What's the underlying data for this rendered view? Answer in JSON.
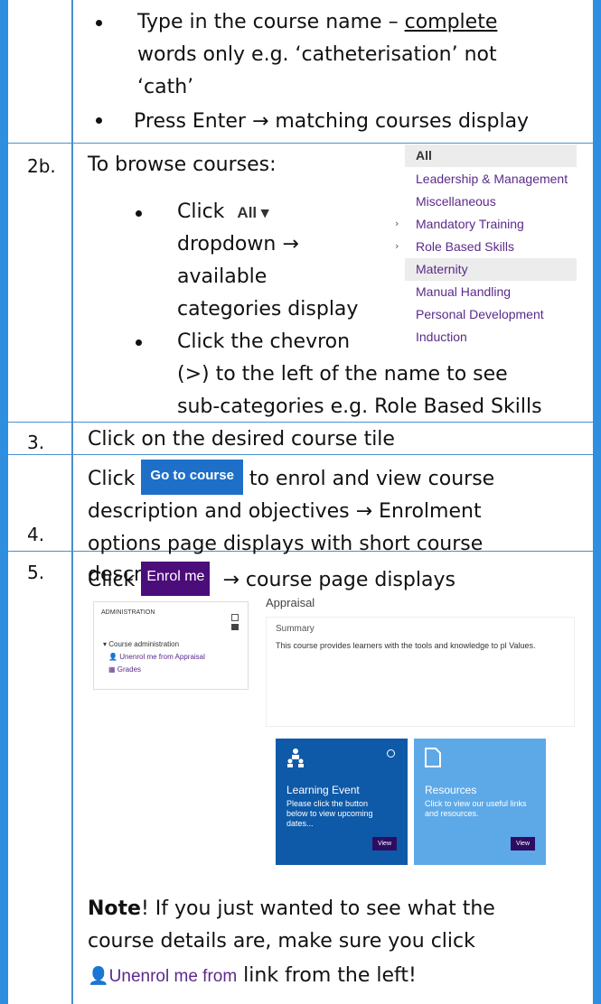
{
  "steps": {
    "bullet_type_1": "Type in the course name – ",
    "bullet_type_u": "complete",
    "bullet_type_2": "words only e.g. ‘catheterisation’ not",
    "bullet_type_3": "‘cath’",
    "bullet_press_a": "Press Enter ",
    "bullet_press_arrow": "→",
    "bullet_press_b": " matching courses display",
    "num_2b": "2b.",
    "browse_title": "To browse courses:",
    "click_label": "Click",
    "all_button": "All ▾",
    "dropdown_a": "dropdown ",
    "dropdown_arrow": "→",
    "available": "available",
    "categories_display": "categories display",
    "chevron_1": "Click the chevron",
    "chevron_2": "(>) to the left of the name to see",
    "chevron_3": "sub-categories e.g. Role Based Skills",
    "num_3": "3.",
    "step3": "Click on the desired course tile",
    "num_4": "4.",
    "step4_click": "Click",
    "go_button": "Go to course",
    "step4_a": " to enrol and view course",
    "step4_b_a": "description and objectives ",
    "step4_b_arrow": "→",
    "step4_b_b": " Enrolment",
    "step4_c": "options page displays with short course",
    "step4_d": "description",
    "num_5": "5.",
    "step5_click": "Click",
    "enrol_button": "Enrol me",
    "step5_arrow": "→",
    "step5_rest": " course page displays"
  },
  "categories": {
    "all": "All",
    "leadership": "Leadership & Management",
    "misc": "Miscellaneous",
    "mandatory": "Mandatory Training",
    "role": "Role Based Skills",
    "maternity": "Maternity",
    "manual": "Manual Handling",
    "personal": "Personal Development",
    "induction": "Induction",
    "chevron": "›"
  },
  "admin_panel": {
    "header": "ADMINISTRATION",
    "course_admin": "▾ Course administration",
    "unenrol": "Unenrol me from Appraisal",
    "grades": "Grades"
  },
  "course_page": {
    "title": "Appraisal",
    "summary_h": "Summary",
    "summary_t": "This course provides learners with the tools and knowledge to pl Values."
  },
  "tiles": {
    "t1_title": "Learning Event",
    "t1_desc": "Please click the button below to view upcoming dates...",
    "t2_title": "Resources",
    "t2_desc": "Click to view our useful links and resources.",
    "view": "View"
  },
  "note": {
    "bold": "Note",
    "rest1": "! If you just wanted to see what the",
    "rest2": "course details are, make sure you click",
    "unenrol_link": "Unenrol me from",
    "rest3": " link from the left!"
  },
  "colors": {
    "border": "#2e8fe0",
    "purple": "#5b2a8a",
    "go_blue": "#1e6fc7",
    "enrol_purple": "#4b0d7a"
  }
}
